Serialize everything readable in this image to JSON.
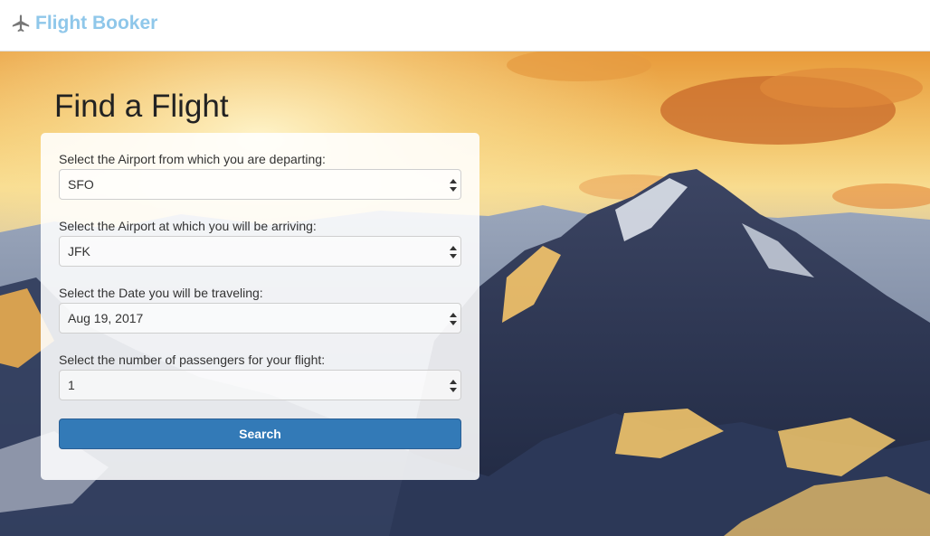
{
  "navbar": {
    "brand": "Flight Booker",
    "brand_color": "#8fc7ea",
    "icon": "airplane-icon"
  },
  "hero": {
    "title": "Find a Flight",
    "background": "mountain-sunset-image"
  },
  "form": {
    "departure": {
      "label": "Select the Airport from which you are departing:",
      "value": "SFO"
    },
    "arrival": {
      "label": "Select the Airport at which you will be arriving:",
      "value": "JFK"
    },
    "date": {
      "label": "Select the Date you will be traveling:",
      "value": "Aug 19, 2017"
    },
    "passengers": {
      "label": "Select the number of passengers for your flight:",
      "value": "1"
    },
    "search_label": "Search",
    "search_color": "#337ab7"
  }
}
